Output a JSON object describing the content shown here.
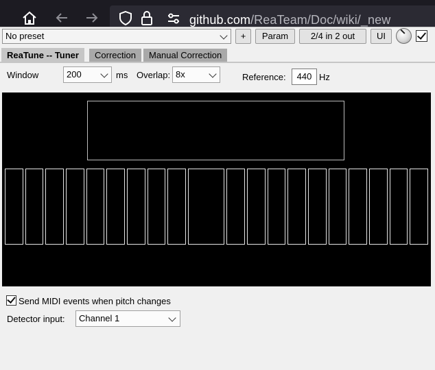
{
  "browser": {
    "url_host": "github.com",
    "url_path": "/ReaTeam/Doc/wiki/_new"
  },
  "toolbar": {
    "preset": "No preset",
    "add_label": "+",
    "param_label": "Param",
    "routing_label": "2/4 in 2 out",
    "ui_label": "UI",
    "bypass_checked": true
  },
  "tabs": [
    {
      "label": "ReaTune -- Tuner",
      "active": true
    },
    {
      "label": "Correction",
      "active": false
    },
    {
      "label": "Manual Correction",
      "active": false
    }
  ],
  "settings": {
    "window_label": "Window",
    "window_value": "200",
    "window_unit": "ms",
    "overlap_label": "Overlap:",
    "overlap_value": "8x",
    "reference_label": "Reference:",
    "reference_value": "440",
    "reference_unit": "Hz"
  },
  "tuner": {
    "segment_count": 20
  },
  "bottom": {
    "midi_label": "Send MIDI events when pitch changes",
    "midi_checked": true,
    "detector_label": "Detector input:",
    "detector_value": "Channel 1"
  }
}
